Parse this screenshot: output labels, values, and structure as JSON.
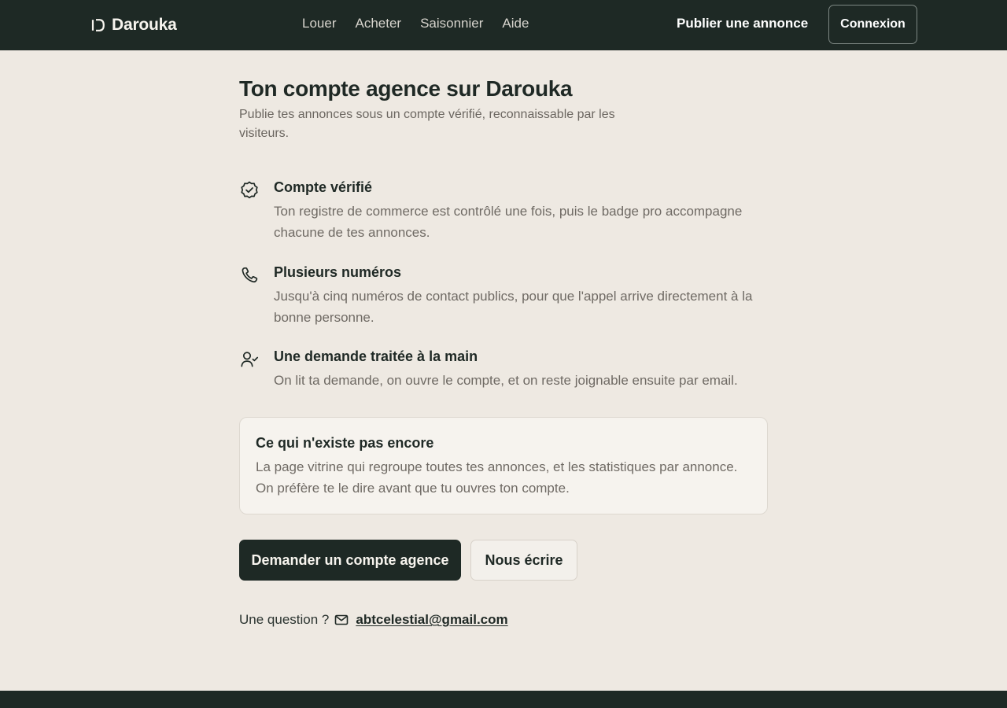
{
  "header": {
    "brand": "Darouka",
    "nav": [
      "Louer",
      "Acheter",
      "Saisonnier",
      "Aide"
    ],
    "publish_label": "Publier une annonce",
    "login_label": "Connexion"
  },
  "main": {
    "title": "Ton compte agence sur Darouka",
    "subtitle": "Publie tes annonces sous un compte vérifié, reconnaissable par les visiteurs.",
    "features": [
      {
        "icon": "verified-badge-icon",
        "title": "Compte vérifié",
        "text": "Ton registre de commerce est contrôlé une fois, puis le badge pro accompagne chacune de tes annonces."
      },
      {
        "icon": "phone-icon",
        "title": "Plusieurs numéros",
        "text": "Jusqu'à cinq numéros de contact publics, pour que l'appel arrive directement à la bonne personne."
      },
      {
        "icon": "user-check-icon",
        "title": "Une demande traitée à la main",
        "text": "On lit ta demande, on ouvre le compte, et on reste joignable ensuite par email."
      }
    ],
    "notice": {
      "title": "Ce qui n'existe pas encore",
      "text": "La page vitrine qui regroupe toutes tes annonces, et les statistiques par annonce. On préfère te le dire avant que tu ouvres ton compte."
    },
    "actions": {
      "primary_label": "Demander un compte agence",
      "secondary_label": "Nous écrire"
    },
    "contact": {
      "prefix": "Une question ?",
      "email": "abtcelestial@gmail.com"
    }
  },
  "colors": {
    "dark": "#1E2925",
    "background": "#EEE9E2",
    "muted_text": "#6F6A64"
  }
}
